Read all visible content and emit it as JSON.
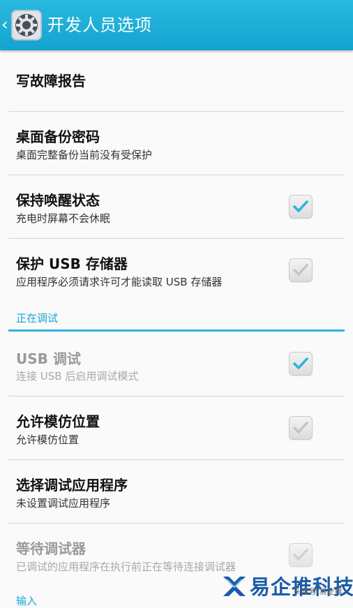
{
  "header": {
    "title": "开发人员选项",
    "back_icon": "chevron-left-icon",
    "app_icon": "settings-gear-icon"
  },
  "items": [
    {
      "id": "bug-report",
      "title": "写故障报告"
    },
    {
      "id": "backup-password",
      "title": "桌面备份密码",
      "subtitle": "桌面完整备份当前没有受保护"
    },
    {
      "id": "stay-awake",
      "title": "保持唤醒状态",
      "subtitle": "充电时屏幕不会休眠",
      "checked": true
    },
    {
      "id": "protect-usb",
      "title": "保护 USB 存储器",
      "subtitle": "应用程序必须请求许可才能读取 USB 存储器",
      "checked": false
    }
  ],
  "debug_section": {
    "label": "正在调试"
  },
  "debug_items": [
    {
      "id": "usb-debugging",
      "title": "USB 调试",
      "subtitle": "连接 USB 后启用调试模式",
      "checked": true,
      "enabled": false
    },
    {
      "id": "mock-location",
      "title": "允许模仿位置",
      "subtitle": "允许模仿位置",
      "checked": false
    },
    {
      "id": "debug-app",
      "title": "选择调试应用程序",
      "subtitle": "未设置调试应用程序"
    },
    {
      "id": "wait-debugger",
      "title": "等待调试器",
      "subtitle": "已调试的应用程序在执行前正在等待连接调试器",
      "checked": false,
      "enabled": false
    }
  ],
  "input_section": {
    "label": "输入"
  },
  "watermark": {
    "text": "易企推科技",
    "small": "头条号/易企推"
  },
  "colors": {
    "accent": "#1aa6d6",
    "topbar": "#1fafd9",
    "check": "#29b2e0"
  }
}
